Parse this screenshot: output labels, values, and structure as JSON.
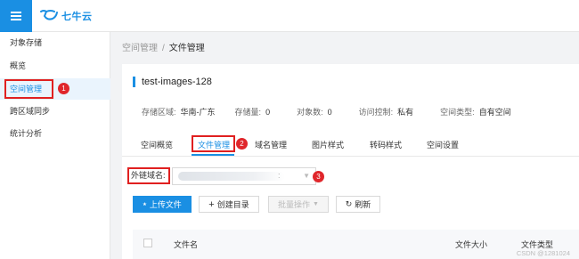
{
  "app": {
    "logo_text": "七牛云"
  },
  "sidebar": {
    "items": [
      {
        "label": "对象存储"
      },
      {
        "label": "概览"
      },
      {
        "label": "空间管理"
      },
      {
        "label": "跨区域同步"
      },
      {
        "label": "统计分析"
      }
    ]
  },
  "breadcrumb": {
    "parent": "空间管理",
    "separator": "/",
    "current": "文件管理"
  },
  "bucket": {
    "name": "test-images-128",
    "stats": [
      {
        "label": "存储区域:",
        "value": "华南-广东"
      },
      {
        "label": "存储量:",
        "value": "0"
      },
      {
        "label": "对象数:",
        "value": "0"
      },
      {
        "label": "访问控制:",
        "value": "私有"
      },
      {
        "label": "空间类型:",
        "value": "自有空间"
      }
    ]
  },
  "tabs": [
    {
      "label": "空间概览"
    },
    {
      "label": "文件管理"
    },
    {
      "label": "域名管理"
    },
    {
      "label": "图片样式"
    },
    {
      "label": "转码样式"
    },
    {
      "label": "空间设置"
    }
  ],
  "domain": {
    "label": "外链域名:",
    "colon": ":"
  },
  "toolbar": {
    "upload": "上传文件",
    "create_dir": "创建目录",
    "batch": "批量操作",
    "refresh": "刷新"
  },
  "table": {
    "headers": {
      "name": "文件名",
      "size": "文件大小",
      "type": "文件类型"
    }
  },
  "annotations": {
    "one": "1",
    "two": "2",
    "three": "3"
  },
  "watermark": "CSDN @1281024",
  "colors": {
    "accent": "#1a8fe3",
    "highlight": "#e02020"
  }
}
